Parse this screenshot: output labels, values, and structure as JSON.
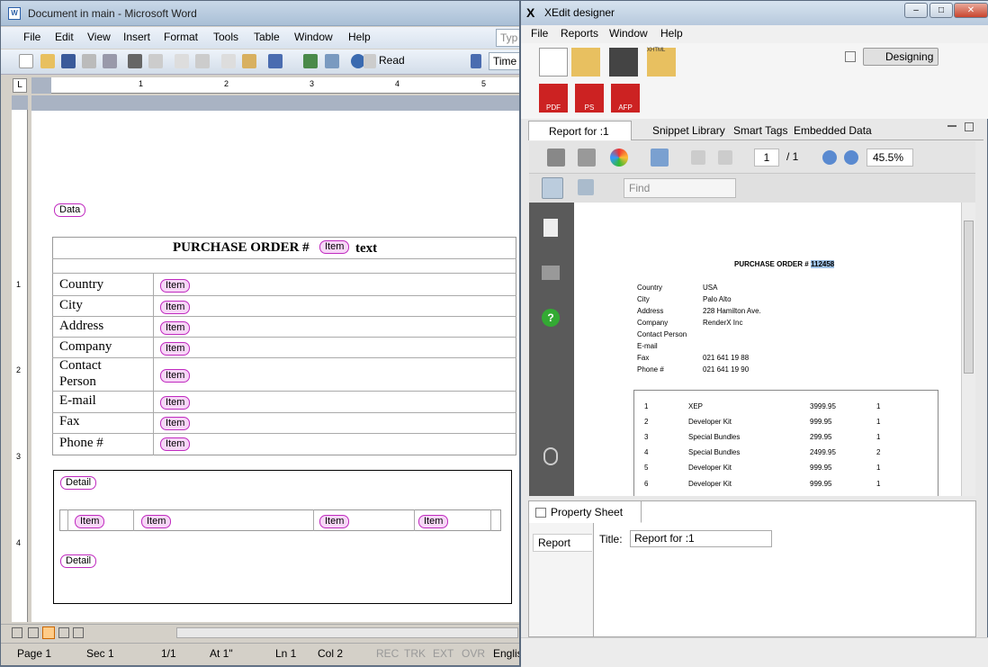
{
  "word": {
    "title": "Document in main - Microsoft Word",
    "menu": [
      "File",
      "Edit",
      "View",
      "Insert",
      "Format",
      "Tools",
      "Table",
      "Window",
      "Help"
    ],
    "type_question": "Typ",
    "read_label": "Read",
    "font_name": "Time",
    "ruler_numbers": [
      "1",
      "2",
      "3",
      "4",
      "5"
    ],
    "vruler_numbers": [
      "1",
      "2",
      "3",
      "4"
    ],
    "doc": {
      "data_tag": "Data",
      "title_prefix": "PURCHASE ORDER #",
      "item_tag": "Item",
      "text_tag": "text",
      "fields": [
        "Country",
        "City",
        "Address",
        "Company",
        "Contact Person",
        "E-mail",
        "Fax",
        "Phone #"
      ],
      "detail_tag": "Detail",
      "detail_end_tag": "Detail"
    },
    "status": {
      "page": "Page  1",
      "sec": "Sec  1",
      "pages": "1/1",
      "at": "At  1\"",
      "ln": "Ln  1",
      "col": "Col  2",
      "rec": "REC",
      "trk": "TRK",
      "ext": "EXT",
      "ovr": "OVR",
      "lang": "Englis"
    }
  },
  "xedit": {
    "title": "XEdit designer",
    "menu": [
      "File",
      "Reports",
      "Window",
      "Help"
    ],
    "designing_label": "Designing",
    "tabs": [
      "Report for :1",
      "Snippet Library",
      "Smart Tags",
      "Embedded Data"
    ],
    "find_placeholder": "Find",
    "page_current": "1",
    "page_total": "/ 1",
    "zoom": "45.5%",
    "preview": {
      "title_prefix": "PURCHASE ORDER #",
      "po_number": "112458",
      "fields": [
        {
          "label": "Country",
          "value": "USA"
        },
        {
          "label": "City",
          "value": "Palo Alto"
        },
        {
          "label": "Address",
          "value": "228 Hamilton Ave."
        },
        {
          "label": "Company",
          "value": "RenderX Inc"
        },
        {
          "label": "Contact Person",
          "value": ""
        },
        {
          "label": "E-mail",
          "value": ""
        },
        {
          "label": "Fax",
          "value": "021 641 19 88"
        },
        {
          "label": "Phone #",
          "value": "021 641 19 90"
        }
      ],
      "items": [
        {
          "n": "1",
          "name": "XEP",
          "price": "3999.95",
          "qty": "1"
        },
        {
          "n": "2",
          "name": "Developer Kit",
          "price": "999.95",
          "qty": "1"
        },
        {
          "n": "3",
          "name": "Special Bundles",
          "price": "299.95",
          "qty": "1"
        },
        {
          "n": "4",
          "name": "Special Bundles",
          "price": "2499.95",
          "qty": "2"
        },
        {
          "n": "5",
          "name": "Developer Kit",
          "price": "999.95",
          "qty": "1"
        },
        {
          "n": "6",
          "name": "Developer Kit",
          "price": "999.95",
          "qty": "1"
        }
      ]
    },
    "property_sheet": {
      "tab_label": "Property Sheet",
      "section": "Report",
      "title_label": "Title:",
      "title_value": "Report for :1"
    },
    "icon_labels": {
      "pdf": "PDF",
      "ps": "PS",
      "afp": "AFP",
      "xhtml": "XHTML"
    }
  }
}
